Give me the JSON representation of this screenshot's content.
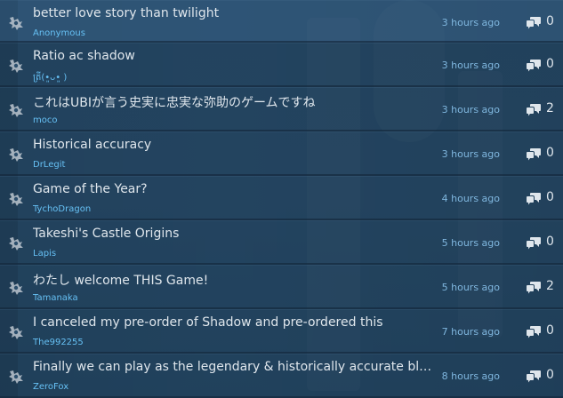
{
  "threads": [
    {
      "title": "better love story than twilight",
      "author": "Anonymous",
      "time": "3 hours ago",
      "replies": "0"
    },
    {
      "title": "Ratio ac shadow",
      "author": "ត្រី(•͈ᴗ•͈ )",
      "time": "3 hours ago",
      "replies": "0"
    },
    {
      "title": "これはUBIが言う史実に忠実な弥助のゲームですね",
      "author": "moco",
      "time": "3 hours ago",
      "replies": "2"
    },
    {
      "title": "Historical accuracy",
      "author": "DrLegit",
      "time": "3 hours ago",
      "replies": "0"
    },
    {
      "title": "Game of the Year?",
      "author": "TychoDragon",
      "time": "4 hours ago",
      "replies": "0"
    },
    {
      "title": "Takeshi's Castle Origins",
      "author": "Lapis",
      "time": "5 hours ago",
      "replies": "0"
    },
    {
      "title": "わたし welcome THIS Game!",
      "author": "Tamanaka",
      "time": "5 hours ago",
      "replies": "2"
    },
    {
      "title": "I canceled my pre-order of Shadow and pre-ordered this",
      "author": "The992255",
      "time": "7 hours ago",
      "replies": "0"
    },
    {
      "title": "Finally we can play as the legendary & historically accurate black s...",
      "author": "ZeroFox",
      "time": "8 hours ago",
      "replies": "0"
    }
  ],
  "icons": {
    "avatar": "thread-author-icon",
    "replies": "speech-bubbles-icon"
  },
  "colors": {
    "author": "#66c0f4",
    "time": "#7fb6de",
    "title": "#dfe6ec"
  }
}
